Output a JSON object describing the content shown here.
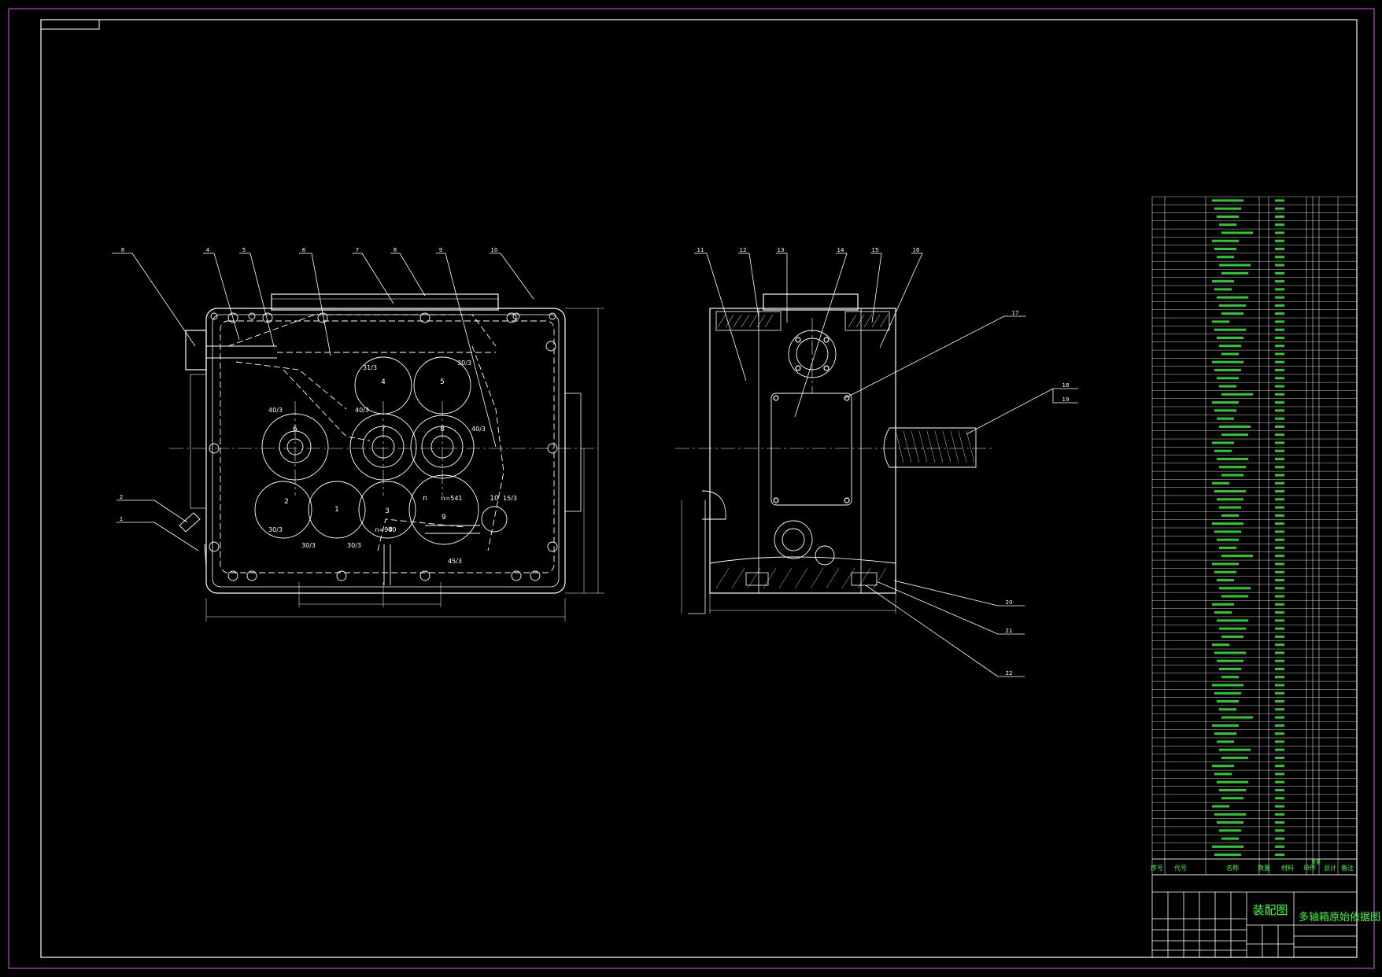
{
  "colors": {
    "background": "#000000",
    "frame_outer": "#9933aa",
    "frame_inner": "#ffffff",
    "geometry": "#ffffff",
    "table_text": "#33ff33"
  },
  "front_view": {
    "leaders": [
      "8",
      "4",
      "5",
      "6",
      "7",
      "8",
      "9",
      "10",
      "2",
      "1"
    ],
    "gears": [
      {
        "id": "4",
        "label": "31/3"
      },
      {
        "id": "5",
        "label": "30/3"
      },
      {
        "id": "6",
        "label": "40/3"
      },
      {
        "id": "7",
        "label": "40/3"
      },
      {
        "id": "8",
        "label": "40/3"
      },
      {
        "id": "2",
        "label": "30/3"
      },
      {
        "id": "1",
        "label": "30/3"
      },
      {
        "id": "3",
        "label": "30/3"
      },
      {
        "id": "0",
        "label": "n=940"
      },
      {
        "id": "n",
        "label": "n=541"
      },
      {
        "id": "9",
        "label": "45/3"
      },
      {
        "id": "10",
        "label": "15/3"
      }
    ]
  },
  "side_view": {
    "leaders": [
      "11",
      "12",
      "13",
      "14",
      "15",
      "16",
      "17",
      "18",
      "19",
      "20",
      "21",
      "22"
    ]
  },
  "title_block": {
    "header_cols": [
      "序号",
      "代号",
      "名称",
      "数量",
      "材料",
      "单件",
      "总计",
      "备注"
    ],
    "weight_label": "重量",
    "drawing_type": "装配图",
    "drawing_name": "多轴箱原始依据图"
  }
}
